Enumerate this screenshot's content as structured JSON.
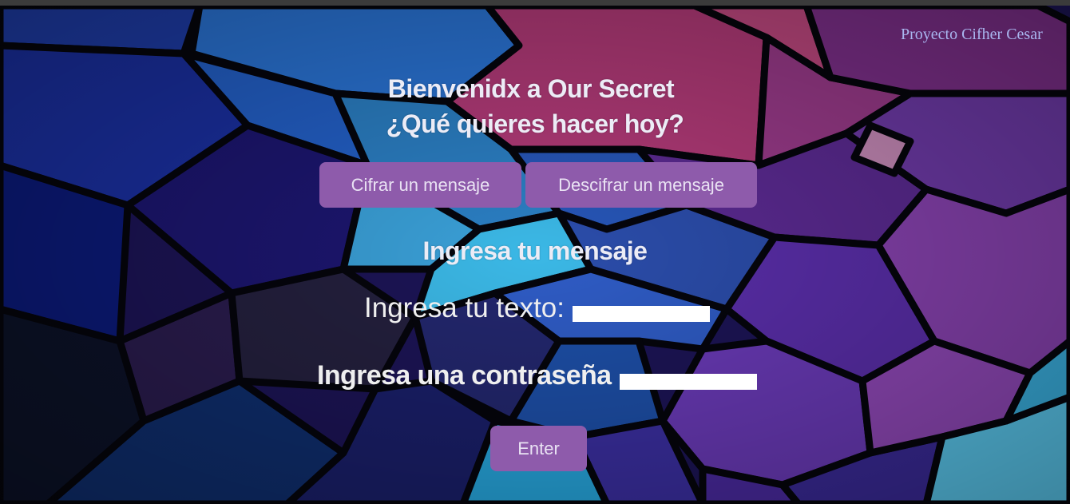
{
  "header": {
    "brand_text": "Proyecto Cifher Cesar"
  },
  "hero": {
    "welcome": "Bienvenidx a Our Secret",
    "question": "¿Qué quieres hacer hoy?"
  },
  "mode_buttons": {
    "encrypt_label": "Cifrar un mensaje",
    "decrypt_label": "Descifrar un mensaje"
  },
  "form": {
    "title": "Ingresa tu mensaje",
    "text_label": "Ingresa tu texto:",
    "text_value": "",
    "password_label": "Ingresa una contraseña",
    "password_value": "",
    "submit_label": "Enter"
  },
  "colors": {
    "button_bg": "#8e5bab",
    "heading_text": "#ececf6",
    "brand_text": "#a9b6ef",
    "input_bg": "#ffffff"
  }
}
